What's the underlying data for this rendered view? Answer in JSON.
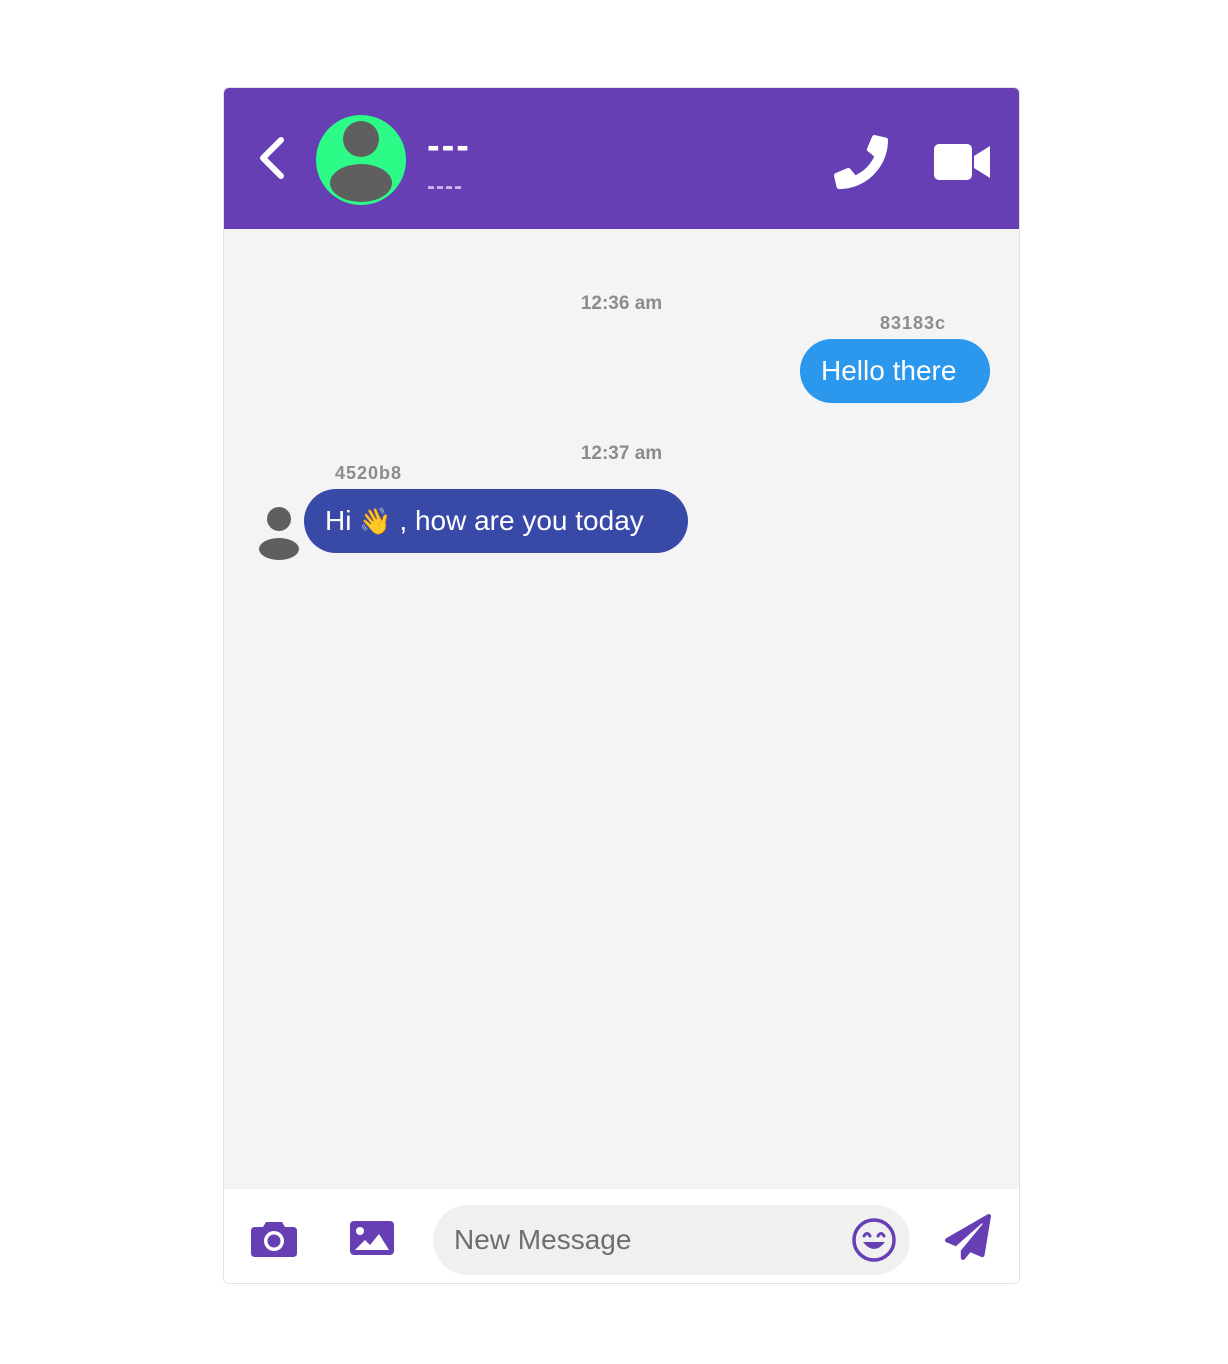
{
  "header": {
    "contact_name": "---",
    "contact_status": "----",
    "icons": [
      "chevron-left-icon",
      "user-avatar-icon",
      "phone-icon",
      "video-camera-icon"
    ],
    "colors": {
      "header_bg": "#673fb4",
      "avatar_bg": "#2dfb88"
    }
  },
  "messages": [
    {
      "timestamp": "12:36 am",
      "sender": "83183c",
      "text": "Hello there",
      "direction": "outgoing"
    },
    {
      "timestamp": "12:37 am",
      "sender": "4520b8",
      "text_before": "Hi ",
      "emoji": "👋",
      "text_after": " , how are you today",
      "direction": "incoming"
    }
  ],
  "composer": {
    "placeholder": "New Message",
    "value": "",
    "icons": [
      "camera-icon",
      "image-icon",
      "smile-icon",
      "send-icon"
    ],
    "accent": "#673fb4"
  },
  "colors": {
    "outgoing_bubble": "#2b97ed",
    "incoming_bubble": "#3849a8"
  }
}
